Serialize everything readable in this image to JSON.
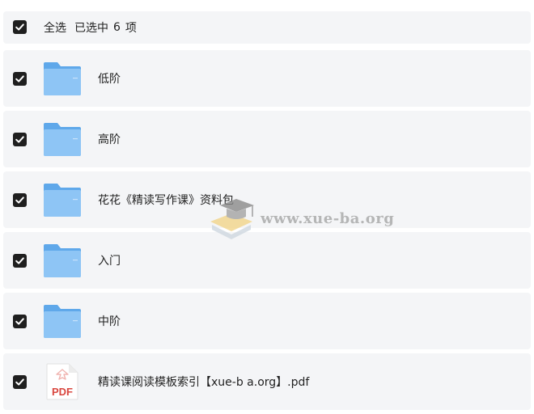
{
  "header": {
    "select_all_label": "全选",
    "selected_prefix": "已选中",
    "selected_count": "6",
    "selected_suffix": "项"
  },
  "files": [
    {
      "name": "低阶",
      "type": "folder",
      "checked": true
    },
    {
      "name": "高阶",
      "type": "folder",
      "checked": true
    },
    {
      "name": "花花《精读写作课》资料包",
      "type": "folder",
      "checked": true
    },
    {
      "name": "入门",
      "type": "folder",
      "checked": true
    },
    {
      "name": "中阶",
      "type": "folder",
      "checked": true
    },
    {
      "name": "精读课阅读模板索引【xue-b a.org】.pdf",
      "type": "pdf",
      "checked": true
    }
  ],
  "icons": {
    "folder": "folder-icon",
    "pdf": "pdf-file-icon",
    "check": "check-icon",
    "pdf_label": "PDF"
  },
  "watermark": {
    "text": "www.xue-ba.org"
  },
  "colors": {
    "row_bg": "#f4f5f7",
    "checkbox": "#1f1f1f",
    "folder_light": "#8ec5f5",
    "folder_dark": "#5fa8ea",
    "pdf_red": "#d9473f"
  }
}
